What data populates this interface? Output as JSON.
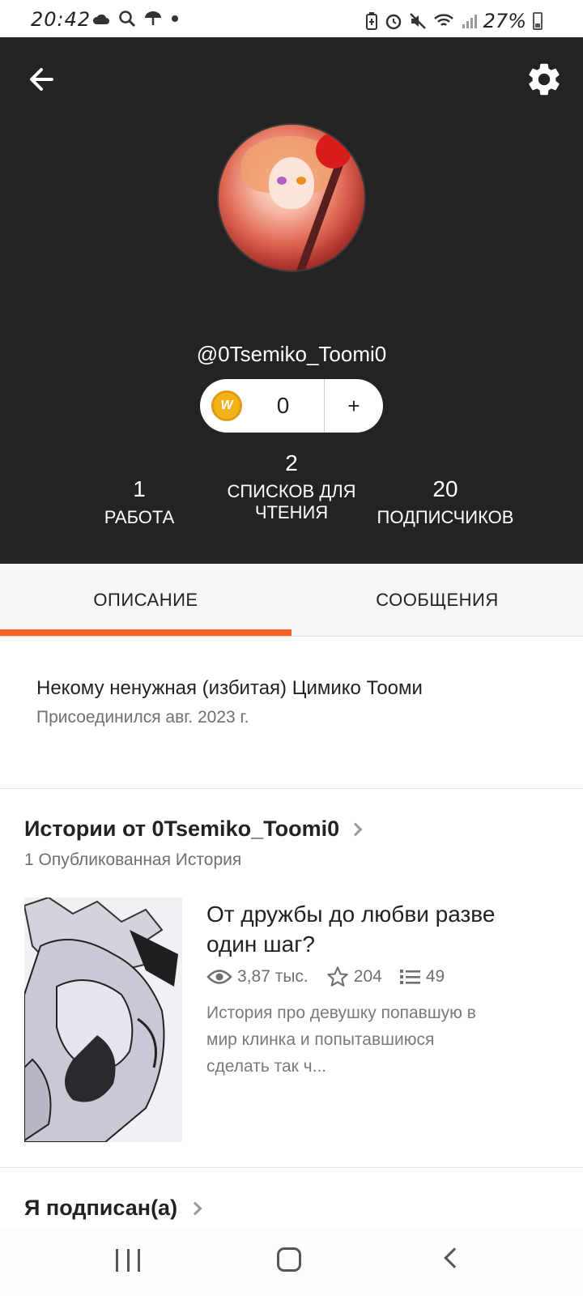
{
  "status_bar": {
    "time": "20:42",
    "battery": "27%",
    "left_icons": [
      "cloud-icon",
      "search-icon",
      "umbrella-icon",
      "dot-icon"
    ],
    "right_icons": [
      "battery-saver-icon",
      "alarm-icon",
      "mute-icon",
      "wifi-icon",
      "signal-icon",
      "battery-icon"
    ]
  },
  "header": {
    "back_icon": "arrow-left-icon",
    "settings_icon": "gear-icon",
    "username": "@0Tsemiko_Toomi0",
    "coins": {
      "icon_letter": "W",
      "count": "0",
      "add_label": "+"
    },
    "stats": [
      {
        "value": "1",
        "label": "РАБОТА"
      },
      {
        "value": "2",
        "label": "СПИСКОВ ДЛЯ ЧТЕНИЯ"
      },
      {
        "value": "20",
        "label": "ПОДПИСЧИКОВ"
      }
    ]
  },
  "tabs": [
    {
      "label": "ОПИСАНИЕ",
      "active": true
    },
    {
      "label": "СООБЩЕНИЯ",
      "active": false
    }
  ],
  "accent_color": "#ff6122",
  "about": {
    "bio": "Некому ненужная (избитая) Цимико Тооми",
    "joined": "Присоединился авг. 2023 г."
  },
  "stories": {
    "title": "Истории от 0Tsemiko_Toomi0",
    "subtitle": "1 Опубликованная История",
    "items": [
      {
        "title": "От дружбы до любви разве один шаг?",
        "reads": "3,87 тыс.",
        "votes": "204",
        "parts": "49",
        "description": "История про девушку попавшую в мир клинка и попытавшиюся сделать так ч..."
      }
    ]
  },
  "following": {
    "title": "Я подписан(а)"
  },
  "nav_bar": {
    "icons": [
      "recents-icon",
      "home-icon",
      "back-icon"
    ]
  }
}
